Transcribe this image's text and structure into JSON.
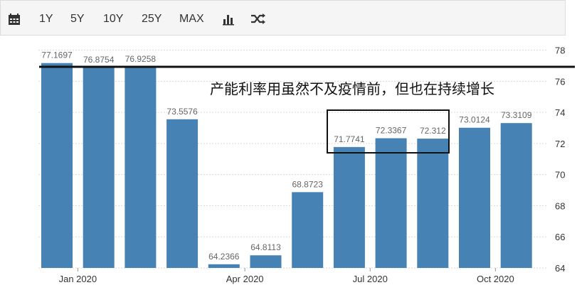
{
  "toolbar": {
    "calendar_icon": "calendar-icon",
    "ranges": [
      "1Y",
      "5Y",
      "10Y",
      "25Y",
      "MAX"
    ],
    "chart_type_icon": "bar-chart-icon",
    "shuffle_icon": "shuffle-icon"
  },
  "colors": {
    "bar": "#4682b4",
    "label": "#666666",
    "axis": "#333333"
  },
  "chart_data": {
    "type": "bar",
    "categories": [
      "",
      "Jan 2020",
      "",
      "",
      "",
      "Apr 2020",
      "",
      "",
      "Jul 2020",
      "",
      "",
      "Oct 2020",
      ""
    ],
    "values": [
      77.1697,
      76.8754,
      76.9258,
      73.5576,
      64.2366,
      64.8113,
      68.8723,
      71.7741,
      72.3367,
      72.312,
      73.0124,
      73.3109
    ],
    "value_labels": [
      "77.1697",
      "76.8754",
      "76.9258",
      "73.5576",
      "64.2366",
      "64.8113",
      "68.8723",
      "71.7741",
      "72.3367",
      "72.312",
      "73.0124",
      "73.3109"
    ],
    "x_tick_labels": [
      "Jan 2020",
      "Apr 2020",
      "Jul 2020",
      "Oct 2020"
    ],
    "y_ticks": [
      64,
      66,
      68,
      70,
      72,
      74,
      76,
      78
    ],
    "ylim": [
      64,
      78.3
    ],
    "annotation": "产能利率用虽然不及疫情前，但也在持续增长",
    "grid": true
  }
}
